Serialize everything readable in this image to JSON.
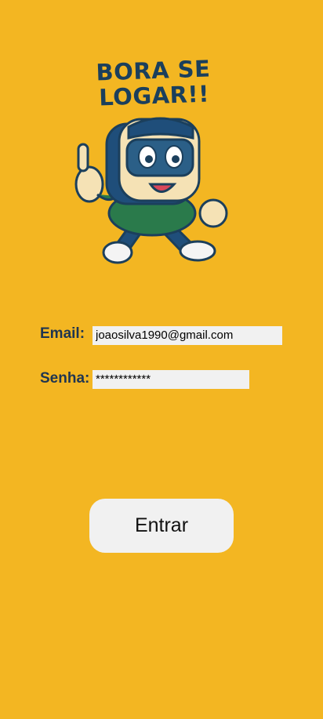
{
  "logo": {
    "line1": "BORA SE",
    "line2": "LOGAR!!"
  },
  "form": {
    "email_label": "Email:",
    "email_value": "joaosilva1990@gmail.com",
    "password_label": "Senha:",
    "password_value": "************"
  },
  "submit_label": "Entrar",
  "colors": {
    "background": "#F3B622",
    "label": "#1F3550",
    "input_bg": "#F1F1F1",
    "button_bg": "#F1F1F1",
    "logo_text": "#1B3F5C"
  },
  "icons": {
    "mascot": "running-robot-mascot-thumbs-up"
  }
}
